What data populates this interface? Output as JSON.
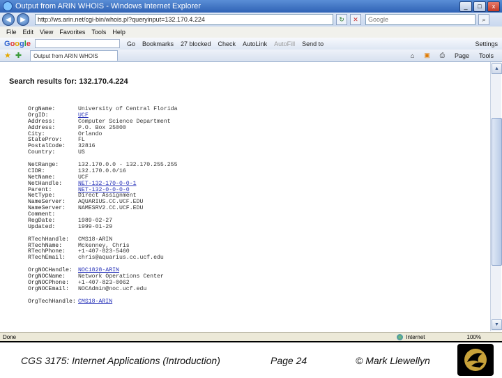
{
  "window": {
    "title": "Output from ARIN WHOIS - Windows Internet Explorer",
    "min": "_",
    "max": "□",
    "close": "x"
  },
  "address_bar": {
    "url": "http://ws.arin.net/cgi-bin/whois.pl?queryinput=132.170.4.224",
    "search_placeholder": "Google"
  },
  "menu": [
    "File",
    "Edit",
    "View",
    "Favorites",
    "Tools",
    "Help"
  ],
  "google_toolbar": {
    "go": "Go",
    "items": [
      "Bookmarks",
      "27 blocked",
      "Check",
      "AutoLink",
      "AutoFill",
      "Send to",
      "Settings"
    ]
  },
  "tab": {
    "label": "Output from ARIN WHOIS",
    "tools": [
      "Page",
      "Tools"
    ]
  },
  "content": {
    "search_title": "Search results for: 132.170.4.224",
    "groups": [
      [
        {
          "k": "OrgName:",
          "v": "University of Central Florida",
          "link": false
        },
        {
          "k": "OrgID:",
          "v": "UCF",
          "link": true
        },
        {
          "k": "Address:",
          "v": "Computer Science Department",
          "link": false
        },
        {
          "k": "Address:",
          "v": "P.O. Box 25000",
          "link": false
        },
        {
          "k": "City:",
          "v": "Orlando",
          "link": false
        },
        {
          "k": "StateProv:",
          "v": "FL",
          "link": false
        },
        {
          "k": "PostalCode:",
          "v": "32816",
          "link": false
        },
        {
          "k": "Country:",
          "v": "US",
          "link": false
        }
      ],
      [
        {
          "k": "NetRange:",
          "v": "132.170.0.0 - 132.170.255.255",
          "link": false
        },
        {
          "k": "CIDR:",
          "v": "132.170.0.0/16",
          "link": false
        },
        {
          "k": "NetName:",
          "v": "UCF",
          "link": false
        },
        {
          "k": "NetHandle:",
          "v": "NET-132-170-0-0-1",
          "link": true
        },
        {
          "k": "Parent:",
          "v": "NET-132-0-0-0-0",
          "link": true
        },
        {
          "k": "NetType:",
          "v": "Direct Assignment",
          "link": false
        },
        {
          "k": "NameServer:",
          "v": "AQUARIUS.CC.UCF.EDU",
          "link": false
        },
        {
          "k": "NameServer:",
          "v": "NAMESRV2.CC.UCF.EDU",
          "link": false
        },
        {
          "k": "Comment:",
          "v": "",
          "link": false
        },
        {
          "k": "RegDate:",
          "v": "1989-02-27",
          "link": false
        },
        {
          "k": "Updated:",
          "v": "1999-01-29",
          "link": false
        }
      ],
      [
        {
          "k": "RTechHandle:",
          "v": "CMS18-ARIN",
          "link": false
        },
        {
          "k": "RTechName:",
          "v": "Mckenney, Chris",
          "link": false
        },
        {
          "k": "RTechPhone:",
          "v": "+1-407-823-5460",
          "link": false
        },
        {
          "k": "RTechEmail:",
          "v": "chris@aquarius.cc.ucf.edu",
          "link": false
        }
      ],
      [
        {
          "k": "OrgNOCHandle:",
          "v": "NOC1828-ARIN",
          "link": true
        },
        {
          "k": "OrgNOCName:",
          "v": "Network Operations Center",
          "link": false
        },
        {
          "k": "OrgNOCPhone:",
          "v": "+1-407-823-0062",
          "link": false
        },
        {
          "k": "OrgNOCEmail:",
          "v": "NOCAdmin@noc.ucf.edu",
          "link": false
        }
      ],
      [
        {
          "k": "OrgTechHandle:",
          "v": "CMS18-ARIN",
          "link": true
        }
      ]
    ]
  },
  "status": {
    "text": "Done",
    "zone": "Internet",
    "zoom": "100%"
  },
  "footer": {
    "course": "CGS 3175: Internet Applications (Introduction)",
    "page": "Page 24",
    "copyright": "© Mark Llewellyn"
  }
}
